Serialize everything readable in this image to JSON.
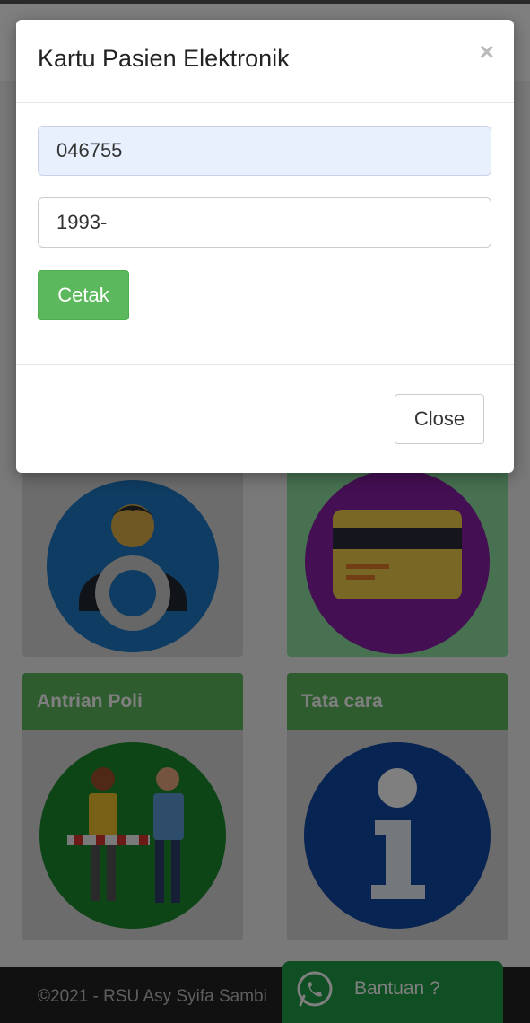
{
  "modal": {
    "title": "Kartu Pasien Elektronik",
    "close_x": "×",
    "patient_number": {
      "value": "046755",
      "placeholder": ""
    },
    "birth_date": {
      "value": "1993-",
      "placeholder": ""
    },
    "print_button": "Cetak",
    "close_button": "Close"
  },
  "cards": [
    {
      "title": "",
      "icon": "admin-gear-icon",
      "color": "#5b9bd5"
    },
    {
      "title": "",
      "icon": "card-icon",
      "color": "#6fcf86"
    },
    {
      "title": "Antrian Poli",
      "icon": "queue-people-icon",
      "color": "#5cb85c"
    },
    {
      "title": "Tata cara",
      "icon": "info-icon",
      "color": "#5cb85c"
    }
  ],
  "footer": {
    "copyright": "©2021 - RSU Asy Syifa Sambi",
    "help_button": "Bantuan ?"
  }
}
